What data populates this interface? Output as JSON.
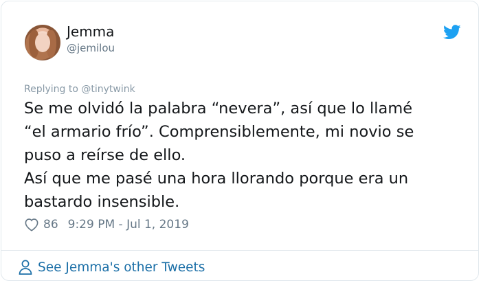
{
  "author": {
    "name": "Jemma",
    "handle": "@jemilou"
  },
  "tweet": {
    "reply_context": "Replying to @tinytwink",
    "lines": [
      "Se me olvidó la palabra “nevera”, así que lo llamé",
      "“el armario frío”. Comprensiblemente, mi novio se",
      "puso a reírse de ello.",
      "Así que me pasé una hora llorando porque  era un",
      "bastardo insensible."
    ],
    "likes": "86",
    "timestamp": "9:29 PM - Jul 1, 2019"
  },
  "footer": {
    "see_more_label": "See Jemma's other Tweets"
  },
  "icons": {
    "brand": "twitter-bird-icon",
    "like": "heart-icon",
    "profile": "person-icon"
  },
  "colors": {
    "twitter_blue": "#1da1f2",
    "link_blue": "#1b6fa7",
    "secondary_text": "#657786",
    "border": "#e1e8ed"
  }
}
